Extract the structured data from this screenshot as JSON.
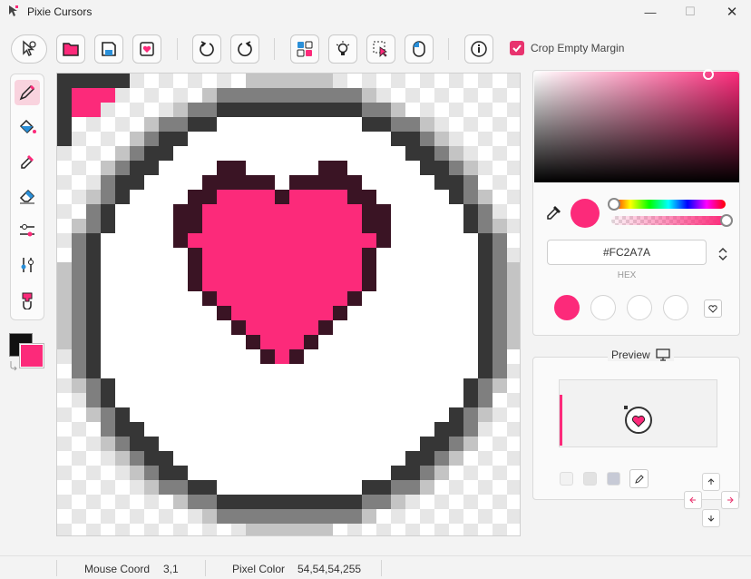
{
  "window": {
    "title": "Pixie Cursors",
    "minimize": "—",
    "maximize": "☐",
    "close": "✕"
  },
  "toolbar": {
    "crop_label": "Crop Empty Margin",
    "crop_checked": true,
    "buttons": [
      "cursor-settings",
      "open-folder",
      "save",
      "heart-save",
      "undo",
      "redo",
      "templates",
      "light-bulb",
      "pointer-select",
      "mouse-color",
      "info"
    ]
  },
  "tools": [
    "pen",
    "bucket-fill",
    "eyedropper",
    "eraser",
    "slider-h",
    "slider-v",
    "stamp"
  ],
  "colors": {
    "primary": "#FC2A7A",
    "secondary": "#111111",
    "accent": "#E8336E"
  },
  "picker": {
    "hex": "#FC2A7A",
    "hex_label": "HEX"
  },
  "preview": {
    "label": "Preview"
  },
  "status": {
    "mouse_coord_label": "Mouse Coord",
    "mouse_coord_value": "3,1",
    "pixel_color_label": "Pixel Color",
    "pixel_color_value": "54,54,54,255"
  }
}
